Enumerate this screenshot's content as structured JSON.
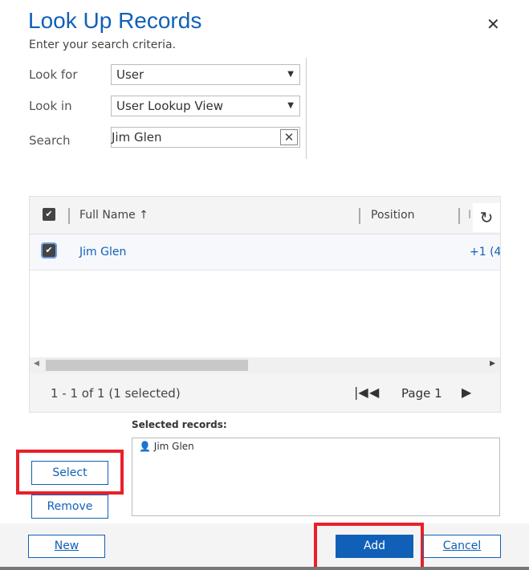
{
  "dialog": {
    "title": "Look Up Records",
    "subtitle": "Enter your search criteria.",
    "close": "✕"
  },
  "form": {
    "look_for_label": "Look for",
    "look_for_value": "User",
    "look_in_label": "Look in",
    "look_in_value": "User Lookup View",
    "search_label": "Search",
    "search_value": "Jim Glen",
    "clear": "✕"
  },
  "grid": {
    "columns": [
      "Full Name",
      "Position",
      "I"
    ],
    "sort_icon": "↑",
    "rows": [
      {
        "name": "Jim Glen",
        "phone": "+1 (4:"
      }
    ],
    "status": "1 - 1 of 1 (1 selected)",
    "page": "Page 1"
  },
  "selected": {
    "label": "Selected records:",
    "items": [
      "Jim Glen"
    ]
  },
  "buttons": {
    "select": "Select",
    "remove": "Remove",
    "new": "New",
    "add": "Add",
    "cancel": "Cancel"
  },
  "colors": {
    "accent": "#1160b7",
    "highlight": "#e8202a"
  }
}
